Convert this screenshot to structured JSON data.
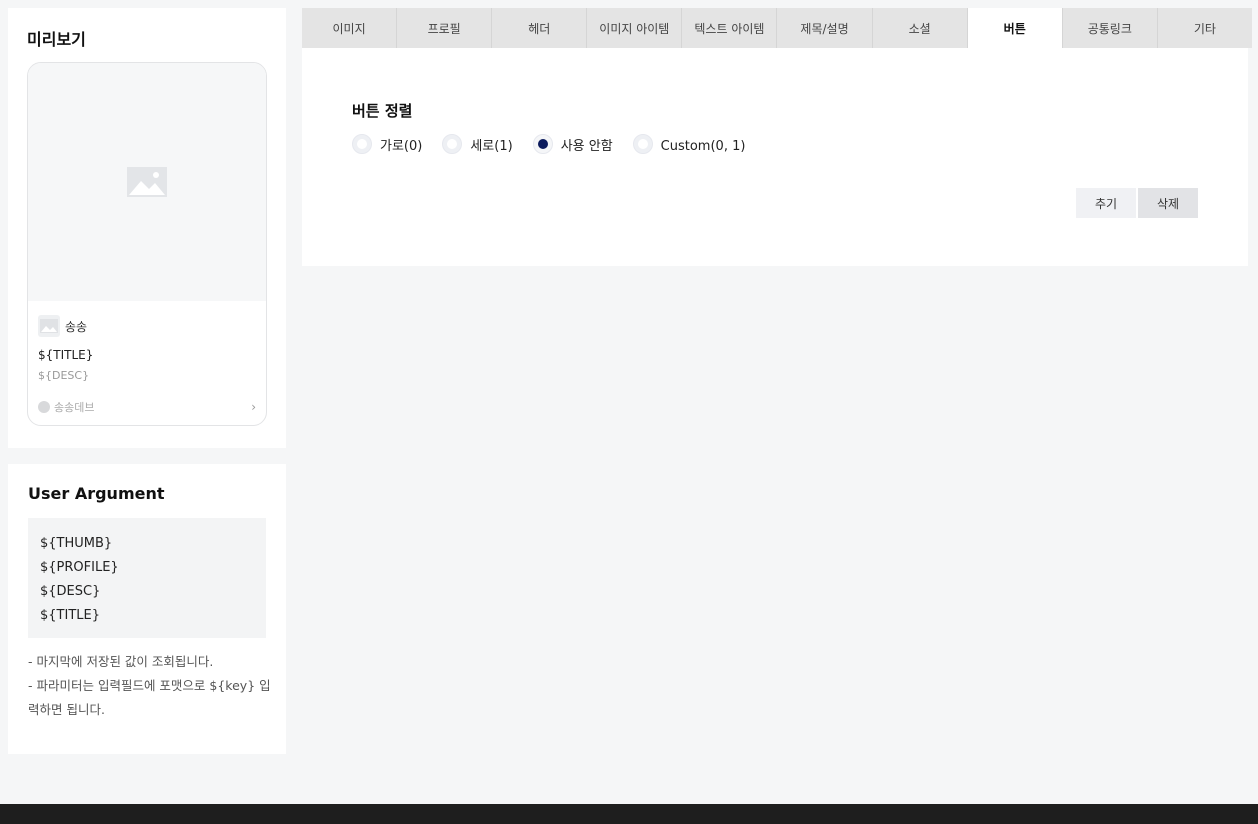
{
  "preview": {
    "title": "미리보기",
    "card": {
      "profile_name": "송송",
      "title": "${TITLE}",
      "desc": "${DESC}",
      "footer_name": "송송데브"
    }
  },
  "user_argument": {
    "title": "User Argument",
    "args": [
      "${THUMB}",
      "${PROFILE}",
      "${DESC}",
      "${TITLE}"
    ],
    "notes": [
      "- 마지막에 저장된 값이 조회됩니다.",
      "- 파라미터는 입력필드에 포맷으로 ${key} 입력하면 됩니다."
    ]
  },
  "tabs": [
    {
      "label": "이미지",
      "active": false
    },
    {
      "label": "프로필",
      "active": false
    },
    {
      "label": "헤더",
      "active": false
    },
    {
      "label": "이미지 아이템",
      "active": false
    },
    {
      "label": "텍스트 아이템",
      "active": false
    },
    {
      "label": "제목/설명",
      "active": false
    },
    {
      "label": "소셜",
      "active": false
    },
    {
      "label": "버튼",
      "active": true
    },
    {
      "label": "공통링크",
      "active": false
    },
    {
      "label": "기타",
      "active": false
    }
  ],
  "button_section": {
    "title": "버튼 정렬",
    "options": [
      {
        "label": "가로(0)",
        "checked": false
      },
      {
        "label": "세로(1)",
        "checked": false
      },
      {
        "label": "사용 안함",
        "checked": true
      },
      {
        "label": "Custom(0, 1)",
        "checked": false
      }
    ],
    "add_label": "추기",
    "delete_label": "삭제"
  },
  "colors": {
    "accent": "#0b1a5c",
    "footer": "#1e1e1e"
  }
}
